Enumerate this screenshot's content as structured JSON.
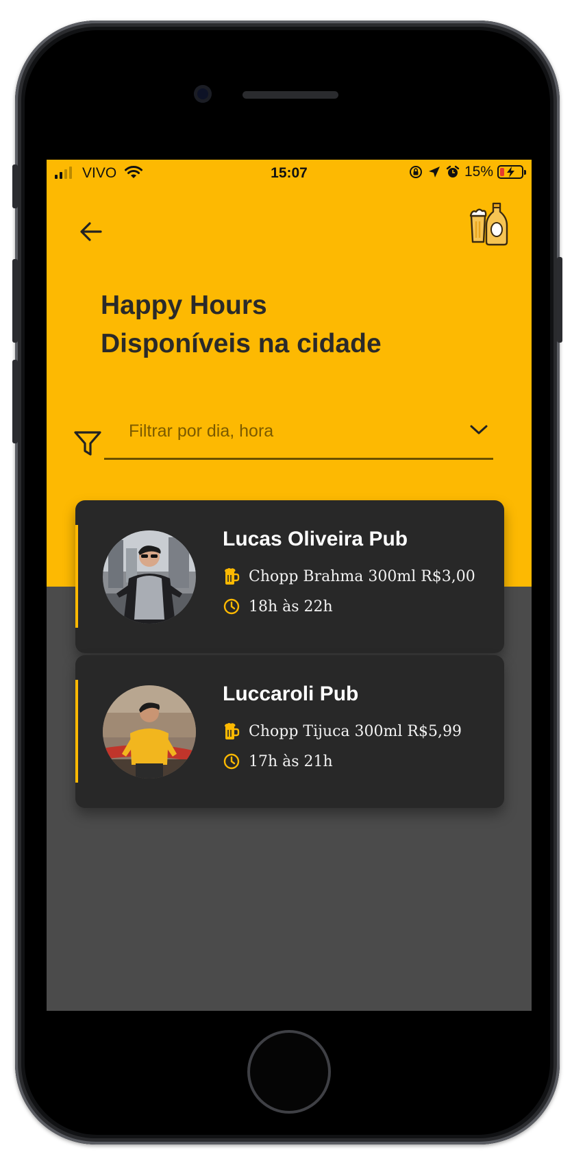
{
  "status_bar": {
    "carrier": "VIVO",
    "time": "15:07",
    "battery_percent": "15%",
    "battery_color": "#e53b2f",
    "icons": [
      "signal-icon",
      "wifi-icon",
      "orientation-lock-icon",
      "location-arrow-icon",
      "alarm-icon",
      "battery-charging-icon"
    ]
  },
  "header": {
    "back_icon": "arrow-left-icon",
    "logo_icon": "beer-glass-and-bottle-icon",
    "title_line1": "Happy Hours",
    "title_line2": "Disponíveis na cidade"
  },
  "filter": {
    "icon": "funnel-icon",
    "placeholder": "Filtrar por dia, hora",
    "dropdown_icon": "chevron-down-icon"
  },
  "pubs": [
    {
      "name": "Lucas Oliveira Pub",
      "offer": "Chopp Brahma 300ml R$3,00",
      "hours": "18h às 22h"
    },
    {
      "name": "Luccaroli Pub",
      "offer": "Chopp Tijuca 300ml R$5,99",
      "hours": "17h às 21h"
    }
  ],
  "colors": {
    "accent": "#fdb902",
    "card_background": "#282828",
    "page_background": "#4b4b4b"
  }
}
